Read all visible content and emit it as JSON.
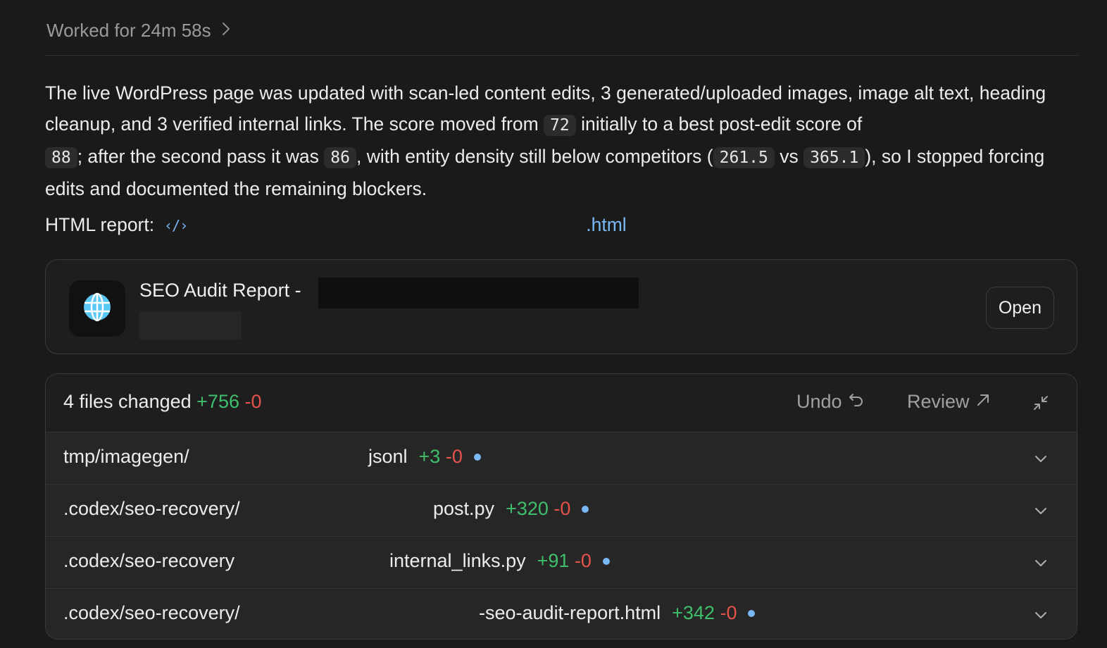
{
  "header": {
    "worked_label": "Worked for 24m 58s"
  },
  "summary": {
    "part1": "The live WordPress page was updated with scan-led content edits, 3 generated/uploaded images, image alt text, heading cleanup, and 3 verified internal links. The score moved from ",
    "initial_score": "72",
    "part2": " initially to a best post-edit score of ",
    "best_score": "88",
    "part3": "; after the second pass it was ",
    "second_score": "86",
    "part4": ", with entity density still below competitors (",
    "entity_density": "261.5",
    "part5": " vs ",
    "competitor_density": "365.1",
    "part6": "), so I stopped forcing edits and documented the remaining blockers."
  },
  "report": {
    "label": "HTML report:",
    "link_suffix": ".html"
  },
  "card": {
    "title": "SEO Audit Report -",
    "open_label": "Open",
    "icon": "globe-icon"
  },
  "files": {
    "summary_label": "4 files changed",
    "added": "+756",
    "removed": "-0",
    "undo_label": "Undo",
    "review_label": "Review",
    "rows": [
      {
        "path": "tmp/imagegen/",
        "name": "jsonl",
        "added": "+3",
        "removed": "-0"
      },
      {
        "path": ".codex/seo-recovery/",
        "name": "post.py",
        "added": "+320",
        "removed": "-0"
      },
      {
        "path": ".codex/seo-recovery",
        "name": "internal_links.py",
        "added": "+91",
        "removed": "-0"
      },
      {
        "path": ".codex/seo-recovery/",
        "name": "-seo-audit-report.html",
        "added": "+342",
        "removed": "-0"
      }
    ]
  },
  "colors": {
    "accent": "#7ab8f5",
    "added": "#3fbf6b",
    "removed": "#e5534b",
    "background": "#1a1a1a"
  }
}
